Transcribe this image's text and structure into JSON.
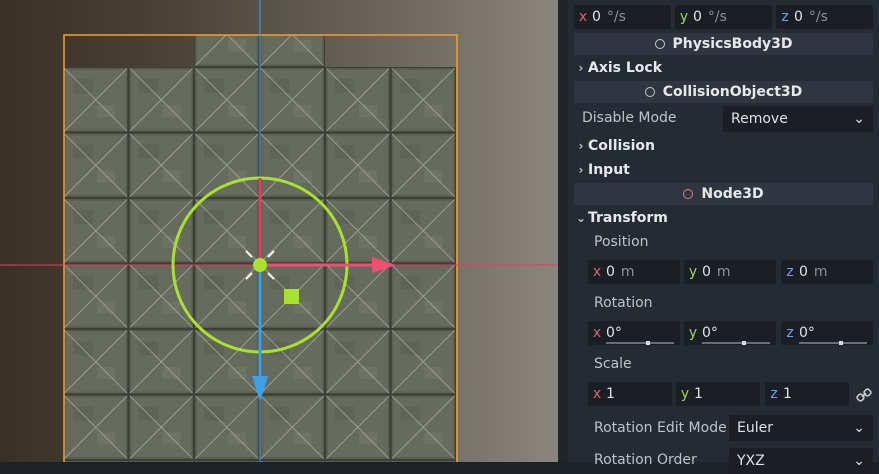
{
  "inspector": {
    "angular_velocity": {
      "x": "0",
      "y": "0",
      "z": "0",
      "unit": "°/s"
    },
    "physics_body_section": "PhysicsBody3D",
    "axis_lock_label": "Axis Lock",
    "collision_object_section": "CollisionObject3D",
    "disable_mode_label": "Disable Mode",
    "disable_mode_value": "Remove",
    "collision_label": "Collision",
    "input_label": "Input",
    "node3d_section": "Node3D",
    "transform_label": "Transform",
    "position_label": "Position",
    "position": {
      "x": "0",
      "y": "0",
      "z": "0",
      "unit": "m"
    },
    "rotation_label": "Rotation",
    "rotation": {
      "x": "0",
      "y": "0",
      "z": "0",
      "unit": "°"
    },
    "scale_label": "Scale",
    "scale": {
      "x": "1",
      "y": "1",
      "z": "1"
    },
    "rotation_edit_mode_label": "Rotation Edit Mode",
    "rotation_edit_mode_value": "Euler",
    "rotation_order_label": "Rotation Order",
    "rotation_order_value": "YXZ"
  },
  "axis_letters": {
    "x": "x",
    "y": "y",
    "z": "z"
  },
  "colors": {
    "gizmo_ring": "#a6e22e",
    "x_axis": "#f0506e",
    "y_axis": "#e04060",
    "z_axis": "#3aa0e8",
    "selection_box": "#f0a030"
  }
}
